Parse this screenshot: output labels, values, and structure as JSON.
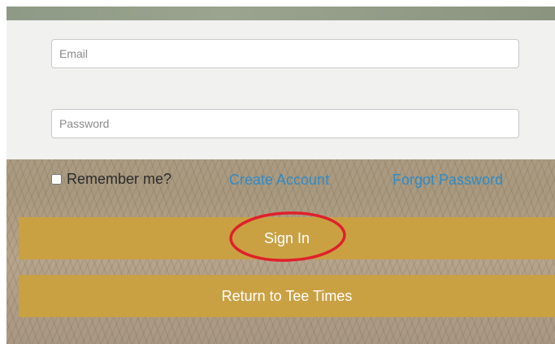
{
  "form": {
    "email_placeholder": "Email",
    "password_placeholder": "Password",
    "remember_label": "Remember me?",
    "create_account_label": "Create Account",
    "forgot_password_label": "Forgot Password",
    "sign_in_label": "Sign In",
    "return_label": "Return to Tee Times"
  },
  "colors": {
    "button_gold": "#c9a143",
    "link_blue": "#2f8bc6",
    "highlight_red": "#e0202a"
  }
}
